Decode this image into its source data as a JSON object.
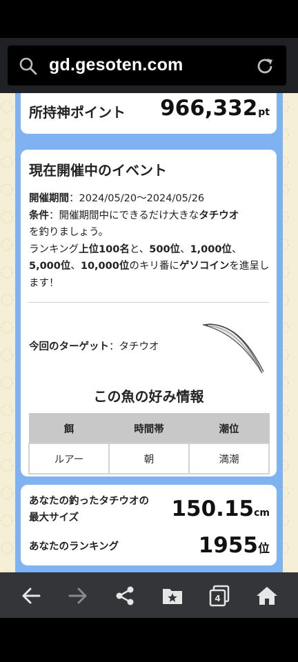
{
  "browser": {
    "url": "gd.gesoten.com",
    "tab_count": "4"
  },
  "points": {
    "label": "所持神ポイント",
    "value": "966,332",
    "unit": "pt"
  },
  "event": {
    "title": "現在開催中のイベント",
    "period_label": "開催期間",
    "period_value": "：2024/05/20〜2024/05/26",
    "condition_label": "条件",
    "condition_text_1": "：開催期間中にできるだけ大きな",
    "condition_fish": "タチウオ",
    "condition_text_2": "を釣りましょう。",
    "rank_text_1": "ランキング",
    "rank_bold_1": "上位100名",
    "rank_text_2": "と、",
    "rank_bold_2": "500位",
    "rank_text_3": "、",
    "rank_bold_3": "1,000位",
    "rank_text_4": "、",
    "rank_bold_4": "5,000位",
    "rank_text_5": "、",
    "rank_bold_5": "10,000位",
    "rank_text_6": "のキリ番に",
    "rank_bold_6": "ゲソコイン",
    "rank_text_7": "を進呈します！",
    "target_label": "今回のターゲット",
    "target_value": "：タチウオ"
  },
  "preferences": {
    "title": "この魚の好み情報",
    "headers": [
      "餌",
      "時間帯",
      "潮位"
    ],
    "values": [
      "ルアー",
      "朝",
      "満潮"
    ]
  },
  "result": {
    "max_size_label_1": "あなたの釣ったタチウオの",
    "max_size_label_2": "最大サイズ",
    "max_size_value": "150.15",
    "max_size_unit": "cm",
    "ranking_label": "あなたのランキング",
    "ranking_value": "1955",
    "ranking_unit": "位"
  },
  "colors": {
    "column_blue": "#7fb2f0",
    "page_cream": "#f6efd8",
    "table_header": "#c8c8c8"
  },
  "icons": [
    "search-icon",
    "reload-icon",
    "back-icon",
    "forward-icon",
    "share-icon",
    "bookmarks-icon",
    "tabs-icon",
    "home-icon"
  ]
}
